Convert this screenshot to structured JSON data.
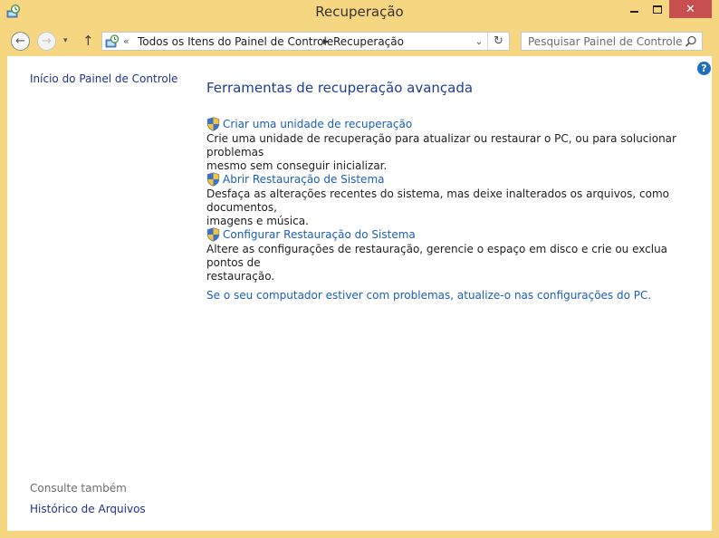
{
  "window": {
    "title": "Recuperação",
    "close_glyph": "✕"
  },
  "nav": {
    "back_glyph": "←",
    "forward_glyph": "→",
    "recent_glyph": "▾",
    "up_glyph": "↑"
  },
  "address": {
    "chevron": "«",
    "crumb_root": "Todos os Itens do Painel de Controle",
    "crumb_separator": "▶",
    "crumb_current": "Recuperação",
    "dropdown_glyph": "⌄",
    "refresh_glyph": "↻"
  },
  "search": {
    "placeholder": "Pesquisar Painel de Controle"
  },
  "sidebar": {
    "home_link": "Início do Painel de Controle",
    "see_also_label": "Consulte também",
    "see_also_items": [
      "Histórico de Arquivos"
    ]
  },
  "main": {
    "heading": "Ferramentas de recuperação avançada",
    "tasks": [
      {
        "title": "Criar uma unidade de recuperação",
        "desc_line1": "Crie uma unidade de recuperação para atualizar ou restaurar o PC, ou para solucionar problemas",
        "desc_line2": "mesmo sem conseguir inicializar."
      },
      {
        "title": "Abrir Restauração de Sistema",
        "desc_line1": "Desfaça as alterações recentes do sistema, mas deixe inalterados os arquivos, como documentos,",
        "desc_line2": "imagens e música."
      },
      {
        "title": "Configurar Restauração do Sistema",
        "desc_line1": "Altere as configurações de restauração, gerencie o espaço em disco e crie ou exclua pontos de",
        "desc_line2": "restauração."
      }
    ],
    "refresh_link": "Se o seu computador estiver com problemas, atualize-o nas configurações do PC."
  },
  "help": {
    "glyph": "?"
  },
  "colors": {
    "frame": "#f6d680",
    "link": "#1a5fb4",
    "heading": "#1e3f8f",
    "close_button": "#c74f4f"
  }
}
